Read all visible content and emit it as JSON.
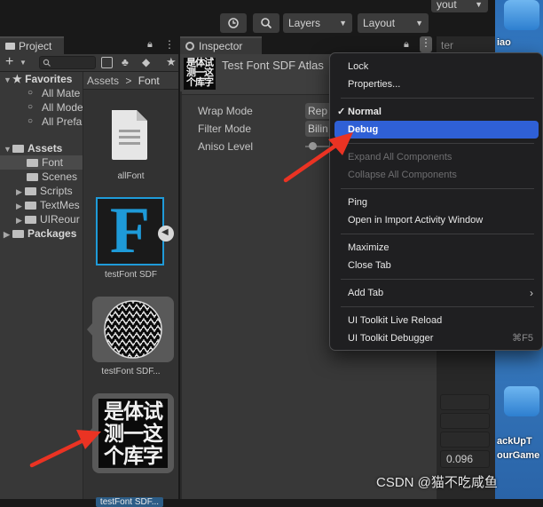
{
  "toolbar": {
    "history_icon": "history-icon",
    "search_icon": "search-icon",
    "layers_label": "Layers",
    "layout_label": "Layout",
    "top_cut_label": "yout"
  },
  "project": {
    "tab_label": "Project",
    "add_label": "+",
    "favorites_label": "Favorites",
    "favorites": [
      "All Mate",
      "All Mode",
      "All Prefa"
    ],
    "assets_label": "Assets",
    "folders": [
      "Font",
      "Scenes",
      "Scripts",
      "TextMes",
      "UIReour"
    ],
    "packages_label": "Packages",
    "breadcrumb": {
      "root": "Assets",
      "separator": ">",
      "current": "Font"
    },
    "items": [
      {
        "label": "allFont"
      },
      {
        "label": "testFont SDF",
        "glyph": "F"
      },
      {
        "label": "testFont SDF..."
      },
      {
        "label": "testFont SDF...",
        "glyphs": [
          "是体试",
          "测一这",
          "个库字"
        ]
      }
    ]
  },
  "inspector": {
    "tab_label": "Inspector",
    "title": "Test Font SDF Atlas",
    "thumb_lines": [
      "是体试",
      "测一这",
      "个库字"
    ],
    "properties": [
      {
        "label": "Wrap Mode",
        "value": "Rep"
      },
      {
        "label": "Filter Mode",
        "value": "Bilin"
      },
      {
        "label": "Aniso Level",
        "value": ""
      }
    ],
    "side_cut_label": "ter",
    "number_value": "0.096"
  },
  "context_menu": {
    "items": [
      {
        "label": "Lock"
      },
      {
        "label": "Properties..."
      },
      {
        "label": "Normal",
        "checked": true
      },
      {
        "label": "Debug",
        "highlighted": true
      },
      {
        "label": "Expand All Components",
        "disabled": true
      },
      {
        "label": "Collapse All Components",
        "disabled": true
      },
      {
        "label": "Ping"
      },
      {
        "label": "Open in Import Activity Window"
      },
      {
        "label": "Maximize"
      },
      {
        "label": "Close Tab"
      },
      {
        "label": "Add Tab",
        "submenu": true
      },
      {
        "label": "UI Toolkit Live Reload"
      },
      {
        "label": "UI Toolkit Debugger",
        "shortcut": "⌘F5"
      }
    ]
  },
  "desktop": {
    "labels": [
      "iao",
      "ackUpT",
      "ourGame"
    ]
  },
  "watermark": "CSDN @猫不吃咸鱼",
  "colors": {
    "highlight": "#2f60d6",
    "selection": "#2c5d87",
    "arrow": "#ea3323"
  }
}
